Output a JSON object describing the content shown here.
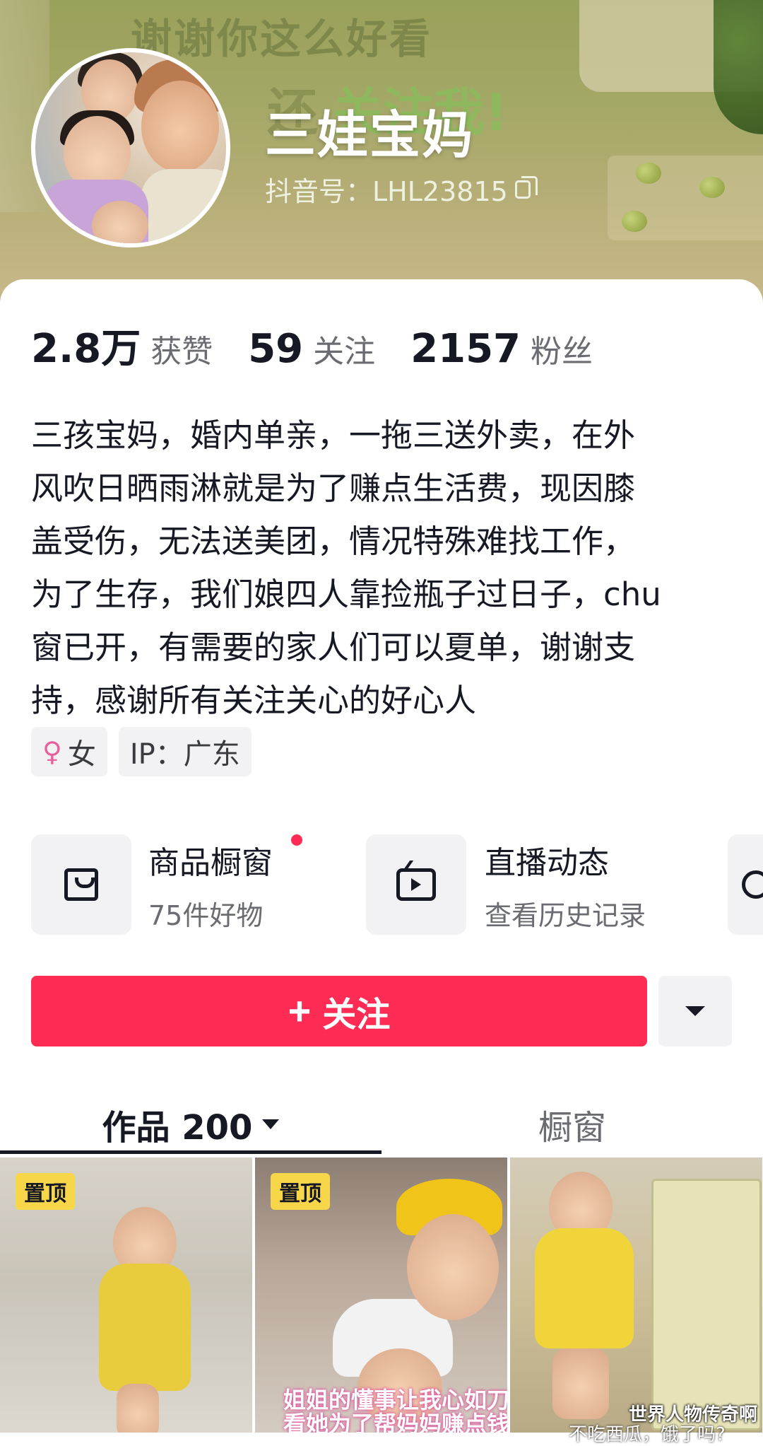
{
  "banner": {
    "overlay_line1": "谢谢你这么好看",
    "overlay_line2_faded": "还",
    "overlay_line2": "关注我!"
  },
  "profile": {
    "name": "三娃宝妈",
    "douyin_id": "抖音号：LHL23815"
  },
  "stats": [
    {
      "value": "2.8万",
      "label": "获赞"
    },
    {
      "value": "59",
      "label": "关注"
    },
    {
      "value": "2157",
      "label": "粉丝"
    }
  ],
  "bio": "三孩宝妈，婚内单亲，一拖三送外卖，在外\n风吹日晒雨淋就是为了赚点生活费，现因膝\n盖受伤，无法送美团，情况特殊难找工作，\n为了生存，我们娘四人靠捡瓶子过日子，chu\n窗已开，有需要的家人们可以夏单，谢谢支\n持，感谢所有关注关心的好心人",
  "tags": {
    "gender": "女",
    "ip": "IP：广东"
  },
  "shortcuts": [
    {
      "title": "商品橱窗",
      "subtitle": "75件好物",
      "icon": "shopping-bag-icon"
    },
    {
      "title": "直播动态",
      "subtitle": "查看历史记录",
      "icon": "tv-icon"
    }
  ],
  "actions": {
    "follow_label": "关注"
  },
  "tabs": [
    {
      "label": "作品 200",
      "active": true
    },
    {
      "label": "橱窗",
      "active": false
    }
  ],
  "videos": [
    {
      "pin_label": "置顶"
    },
    {
      "pin_label": "置顶",
      "overlay_line1": "姐姐的懂事让我心如刀割",
      "overlay_line2": "看她为了帮妈妈赚点钱到"
    },
    {
      "overlay": "不吃西瓜，饿了吗?"
    }
  ],
  "watermark": "世界人物传奇啊",
  "colors": {
    "accent": "#fe2c55",
    "text_primary": "#161823",
    "text_secondary": "#6b6c72",
    "chip_bg": "#f2f2f4"
  }
}
